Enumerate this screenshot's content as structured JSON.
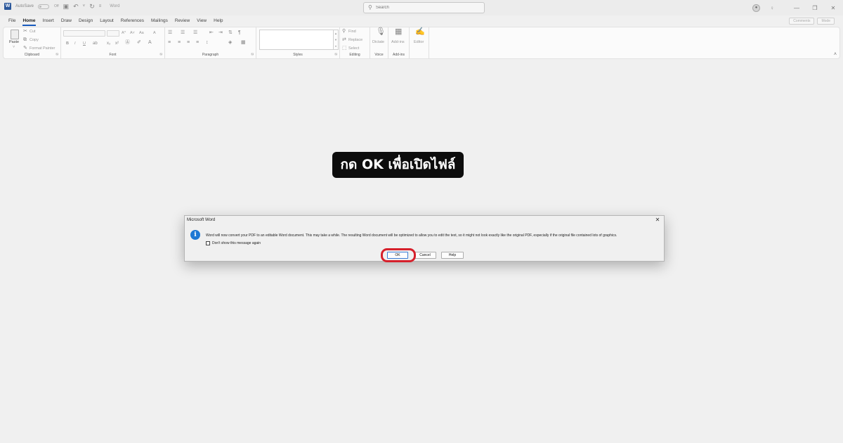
{
  "titlebar": {
    "autosave_label": "AutoSave",
    "autosave_state": "Off",
    "doc_title": "Word",
    "search_placeholder": "Search"
  },
  "ribbon_tabs": [
    "File",
    "Home",
    "Insert",
    "Draw",
    "Design",
    "Layout",
    "References",
    "Mailings",
    "Review",
    "View",
    "Help"
  ],
  "ribbon_tabs_active": "Home",
  "ribbon_right": {
    "comments_label": "Comments",
    "mode_label": "Mode"
  },
  "ribbon": {
    "clipboard": {
      "paste": "Paste",
      "cut": "Cut",
      "copy": "Copy",
      "format_painter": "Format Painter",
      "label": "Clipboard"
    },
    "font": {
      "label": "Font",
      "bold": "B",
      "italic": "I",
      "underline": "U",
      "grow": "A^",
      "shrink": "A˅",
      "change_case": "Aa",
      "clear": "A"
    },
    "paragraph": {
      "label": "Paragraph"
    },
    "styles": {
      "label": "Styles"
    },
    "editing": {
      "find": "Find",
      "replace": "Replace",
      "select": "Select",
      "label": "Editing"
    },
    "voice": {
      "dictate": "Dictate",
      "label": "Voice"
    },
    "addins": {
      "addins": "Add-ins",
      "label": "Add-ins"
    },
    "editor": {
      "editor": "Editor"
    }
  },
  "banner_text": "กด OK เพื่อเปิดไฟล์",
  "dialog": {
    "title": "Microsoft Word",
    "message": "Word will now convert your PDF to an editable Word document. This may take a while. The resulting Word document will be optimized to allow you to edit the text, so it might not look exactly like the original PDF, especially if the original file contained lots of graphics.",
    "checkbox_label": "Don't show this message again",
    "ok_label": "OK",
    "cancel_label": "Cancel",
    "help_label": "Help"
  },
  "colors": {
    "accent": "#185abd",
    "info_icon": "#1e78d4",
    "highlight": "#d6202b",
    "banner_bg": "#0d0d0d"
  }
}
